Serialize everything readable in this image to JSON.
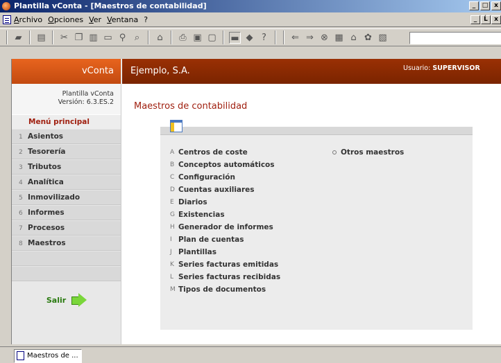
{
  "window": {
    "title": "Plantilla vConta - [Maestros de contabilidad]",
    "buttons": [
      "_",
      "□",
      "x"
    ]
  },
  "menubar": {
    "items": [
      "Archivo",
      "Opciones",
      "Ver",
      "Ventana",
      "?"
    ],
    "mdi_buttons": [
      "_",
      "Ĺ",
      "x"
    ]
  },
  "toolbar": {
    "icons": [
      "open-icon",
      "edit-icon",
      "cut-icon",
      "copy-icon",
      "paste-icon",
      "window-icon",
      "find-icon",
      "search-icon",
      "properties-icon",
      "print-icon",
      "print-preview-icon",
      "save-icon",
      "screen-icon",
      "diamond-icon",
      "help-icon",
      "back-arrow-icon",
      "forward-arrow-icon",
      "stop-icon",
      "refresh-icon",
      "home-icon",
      "favorites-icon",
      "history-icon"
    ],
    "address_value": ""
  },
  "sidebar": {
    "brand": "vConta",
    "version_line1": "Plantilla vConta",
    "version_line2": "Versión: 6.3.ES.2",
    "menu_title": "Menú principal",
    "items": [
      {
        "num": "1",
        "label": "Asientos"
      },
      {
        "num": "2",
        "label": "Tesorería"
      },
      {
        "num": "3",
        "label": "Tributos"
      },
      {
        "num": "4",
        "label": "Analítica"
      },
      {
        "num": "5",
        "label": "Inmovilizado"
      },
      {
        "num": "6",
        "label": "Informes"
      },
      {
        "num": "7",
        "label": "Procesos"
      },
      {
        "num": "8",
        "label": "Maestros"
      }
    ],
    "exit_label": "Salir"
  },
  "header": {
    "company": "Ejemplo, S.A.",
    "user_label": "Usuario:",
    "user_name": "SUPERVISOR"
  },
  "main": {
    "title": "Maestros de contabilidad",
    "masters": [
      {
        "letter": "A",
        "label": "Centros de coste"
      },
      {
        "letter": "B",
        "label": "Conceptos automáticos"
      },
      {
        "letter": "C",
        "label": "Configuración"
      },
      {
        "letter": "D",
        "label": "Cuentas auxiliares"
      },
      {
        "letter": "E",
        "label": "Diarios"
      },
      {
        "letter": "G",
        "label": "Existencias"
      },
      {
        "letter": "H",
        "label": "Generador de informes"
      },
      {
        "letter": "I",
        "label": "Plan de cuentas"
      },
      {
        "letter": "J",
        "label": "Plantillas"
      },
      {
        "letter": "K",
        "label": "Series facturas emitidas"
      },
      {
        "letter": "L",
        "label": "Series facturas recibidas"
      },
      {
        "letter": "M",
        "label": "Tipos de documentos"
      }
    ],
    "other_label": "Otros maestros"
  },
  "taskbar": {
    "item_label": "Maestros de ..."
  }
}
